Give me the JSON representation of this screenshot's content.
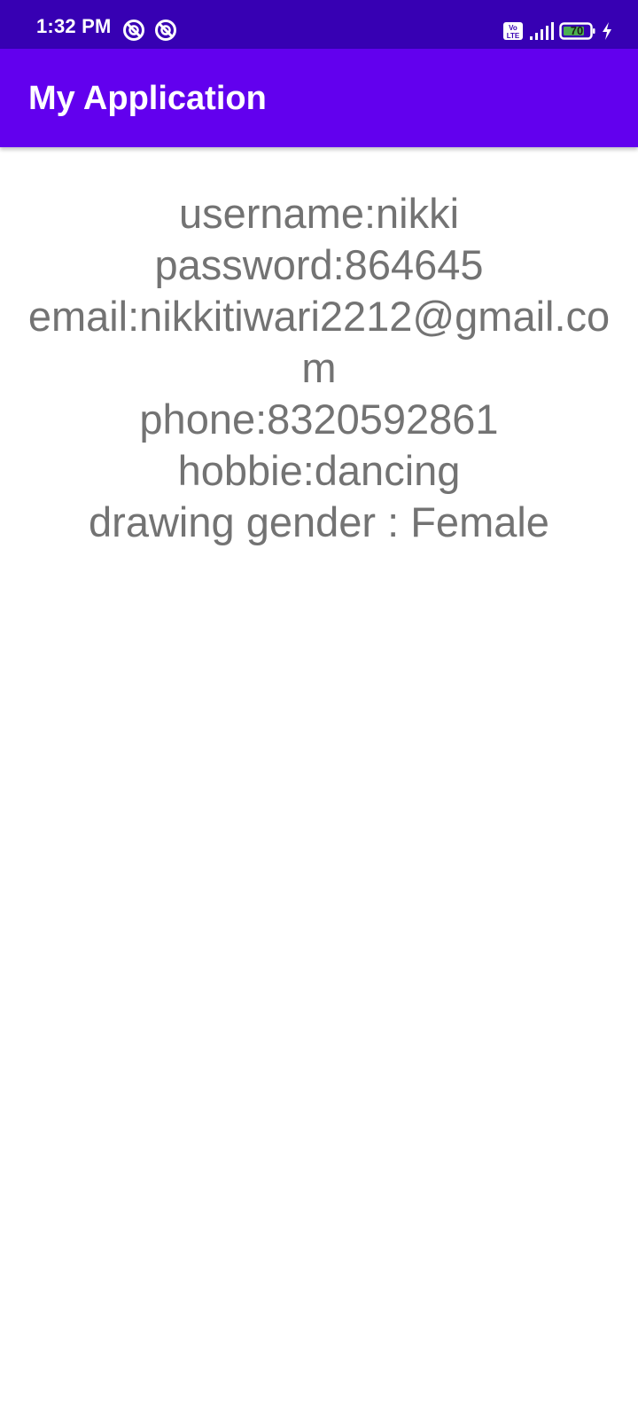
{
  "status_bar": {
    "time": "1:32 PM",
    "left_icons": [
      "sync-disabled-icon",
      "sync-disabled-icon"
    ],
    "right_icons": [
      "volte-icon",
      "signal-icon",
      "battery-icon",
      "charging-icon"
    ],
    "battery_level": "70",
    "color": "#3700b3"
  },
  "app_bar": {
    "title": "My Application",
    "color": "#6200ee"
  },
  "content": {
    "details_text": "username:nikki\npassword:864645\nemail:nikkitiwari2212@gmail.com\nphone:8320592861\nhobbie:dancing\ndrawing gender : Female",
    "text_color": "#737373"
  }
}
